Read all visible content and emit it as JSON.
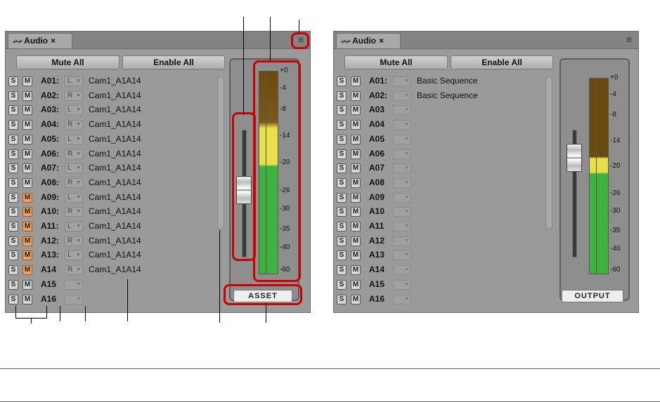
{
  "panel_left": {
    "tab_label": "Audio",
    "mute_all": "Mute All",
    "enable_all": "Enable All",
    "meter_label": "ASSET",
    "tracks": [
      {
        "s": "S",
        "m": "M",
        "name": "A01:",
        "pan": "L",
        "clip": "Cam1_A1A14",
        "muted": false
      },
      {
        "s": "S",
        "m": "M",
        "name": "A02:",
        "pan": "R",
        "clip": "Cam1_A1A14",
        "muted": false
      },
      {
        "s": "S",
        "m": "M",
        "name": "A03:",
        "pan": "L",
        "clip": "Cam1_A1A14",
        "muted": false
      },
      {
        "s": "S",
        "m": "M",
        "name": "A04:",
        "pan": "R",
        "clip": "Cam1_A1A14",
        "muted": false
      },
      {
        "s": "S",
        "m": "M",
        "name": "A05:",
        "pan": "L",
        "clip": "Cam1_A1A14",
        "muted": false
      },
      {
        "s": "S",
        "m": "M",
        "name": "A06:",
        "pan": "R",
        "clip": "Cam1_A1A14",
        "muted": false
      },
      {
        "s": "S",
        "m": "M",
        "name": "A07:",
        "pan": "L",
        "clip": "Cam1_A1A14",
        "muted": false
      },
      {
        "s": "S",
        "m": "M",
        "name": "A08:",
        "pan": "R",
        "clip": "Cam1_A1A14",
        "muted": false
      },
      {
        "s": "S",
        "m": "M",
        "name": "A09:",
        "pan": "L",
        "clip": "Cam1_A1A14",
        "muted": true
      },
      {
        "s": "S",
        "m": "M",
        "name": "A10:",
        "pan": "R",
        "clip": "Cam1_A1A14",
        "muted": true
      },
      {
        "s": "S",
        "m": "M",
        "name": "A11:",
        "pan": "L",
        "clip": "Cam1_A1A14",
        "muted": true
      },
      {
        "s": "S",
        "m": "M",
        "name": "A12:",
        "pan": "R",
        "clip": "Cam1_A1A14",
        "muted": true
      },
      {
        "s": "S",
        "m": "M",
        "name": "A13:",
        "pan": "L",
        "clip": "Cam1_A1A14",
        "muted": true
      },
      {
        "s": "S",
        "m": "M",
        "name": "A14",
        "pan": "R",
        "clip": "Cam1_A1A14",
        "muted": true
      },
      {
        "s": "S",
        "m": "M",
        "name": "A15",
        "pan": "",
        "clip": "",
        "muted": false
      },
      {
        "s": "S",
        "m": "M",
        "name": "A16",
        "pan": "",
        "clip": "",
        "muted": false
      }
    ]
  },
  "panel_right": {
    "tab_label": "Audio",
    "mute_all": "Mute All",
    "enable_all": "Enable All",
    "meter_label": "OUTPUT",
    "tracks": [
      {
        "s": "S",
        "m": "M",
        "name": "A01:",
        "pan": "",
        "clip": "Basic Sequence",
        "muted": false
      },
      {
        "s": "S",
        "m": "M",
        "name": "A02:",
        "pan": "",
        "clip": "Basic Sequence",
        "muted": false
      },
      {
        "s": "S",
        "m": "M",
        "name": "A03",
        "pan": "",
        "clip": "",
        "muted": false
      },
      {
        "s": "S",
        "m": "M",
        "name": "A04",
        "pan": "",
        "clip": "",
        "muted": false
      },
      {
        "s": "S",
        "m": "M",
        "name": "A05",
        "pan": "",
        "clip": "",
        "muted": false
      },
      {
        "s": "S",
        "m": "M",
        "name": "A06",
        "pan": "",
        "clip": "",
        "muted": false
      },
      {
        "s": "S",
        "m": "M",
        "name": "A07",
        "pan": "",
        "clip": "",
        "muted": false
      },
      {
        "s": "S",
        "m": "M",
        "name": "A08",
        "pan": "",
        "clip": "",
        "muted": false
      },
      {
        "s": "S",
        "m": "M",
        "name": "A09",
        "pan": "",
        "clip": "",
        "muted": false
      },
      {
        "s": "S",
        "m": "M",
        "name": "A10",
        "pan": "",
        "clip": "",
        "muted": false
      },
      {
        "s": "S",
        "m": "M",
        "name": "A11",
        "pan": "",
        "clip": "",
        "muted": false
      },
      {
        "s": "S",
        "m": "M",
        "name": "A12",
        "pan": "",
        "clip": "",
        "muted": false
      },
      {
        "s": "S",
        "m": "M",
        "name": "A13",
        "pan": "",
        "clip": "",
        "muted": false
      },
      {
        "s": "S",
        "m": "M",
        "name": "A14",
        "pan": "",
        "clip": "",
        "muted": false
      },
      {
        "s": "S",
        "m": "M",
        "name": "A15",
        "pan": "",
        "clip": "",
        "muted": false
      },
      {
        "s": "S",
        "m": "M",
        "name": "A16",
        "pan": "",
        "clip": "",
        "muted": false
      }
    ]
  },
  "meter_scale": [
    "+0",
    "-4",
    "-8",
    "-14",
    "-20",
    "-26",
    "-30",
    "-35",
    "-40",
    "-60"
  ],
  "close_glyph": "×",
  "colors": {
    "highlight": "#cc0000",
    "mute_on": "#f0a060",
    "meter_green": "#3fb23f",
    "meter_yellow": "#e6e04a",
    "meter_brown": "#6b4a10"
  }
}
